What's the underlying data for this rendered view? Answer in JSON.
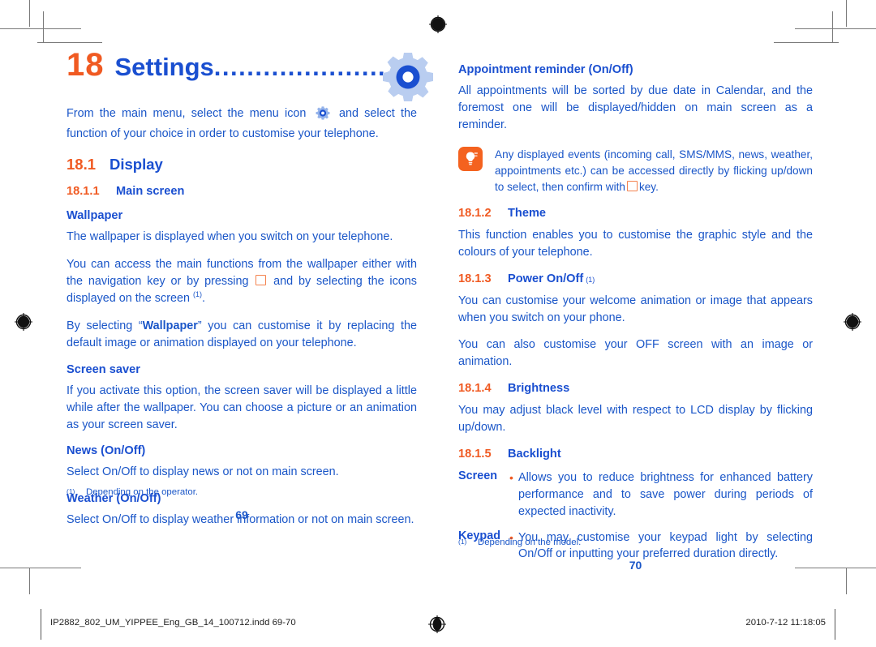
{
  "document": {
    "chapter": {
      "number": "18",
      "name": "Settings",
      "leader": "..........................",
      "gear_icon": "gear-icon"
    },
    "intro": {
      "before_icon": "From the main menu, select the menu icon",
      "after_icon": "and select the function of your choice in order to customise your telephone.",
      "inline_icon": "gear-icon"
    }
  },
  "left_column": {
    "section": {
      "number": "18.1",
      "title": "Display"
    },
    "subsection": {
      "number": "18.1.1",
      "title": "Main screen"
    },
    "blocks": [
      {
        "heading": "Wallpaper",
        "paragraphs": [
          "The wallpaper is displayed when you switch on your telephone.",
          "You can access the main functions from the wallpaper either with the navigation key or by pressing ",
          " and by selecting the icons displayed on the screen ",
          "By selecting “Wallpaper” you can customise it by replacing the default image or animation displayed on your telephone."
        ]
      },
      {
        "heading": "Screen saver",
        "paragraph": "If you activate this option, the screen saver will be displayed a little while after the wallpaper. You can choose a picture or an animation as your screen saver."
      },
      {
        "heading": "News (On/Off)",
        "paragraph": "Select On/Off to display news or not on main screen."
      },
      {
        "heading": "Weather (On/Off)",
        "paragraph": "Select On/Off to display weather information or not on main screen."
      }
    ],
    "wallpaper_emphasis": "Wallpaper",
    "wallpaper_lead": "By selecting “",
    "wallpaper_tail": "” you can customise it by replacing the default image or animation displayed on your telephone.",
    "footnote": {
      "mark": "(1)",
      "text": "Depending on the operator."
    },
    "page_number": "69"
  },
  "right_column": {
    "blocks": [
      {
        "heading": "Appointment reminder (On/Off)",
        "paragraph": "All appointments will be sorted by due date in Calendar, and the foremost one will be displayed/hidden on main screen as a reminder."
      }
    ],
    "tip": {
      "icon": "lightbulb-tip-icon",
      "text_before_key": "Any displayed events (incoming call, SMS/MMS, news, weather, appointments  etc.)  can be accessed directly by flicking up/down to select, then confirm with",
      "text_after_key": "key."
    },
    "theme": {
      "number": "18.1.2",
      "title": "Theme",
      "paragraph": "This function enables you to customise the graphic style and the colours of your telephone."
    },
    "power": {
      "number": "18.1.3",
      "title": "Power On/Off",
      "footnote_mark": "(1)",
      "paragraph_1": "You can customise your welcome animation or image that appears when you switch on your phone.",
      "paragraph_2": "You can also customise your OFF screen with an image or animation."
    },
    "brightness": {
      "number": "18.1.4",
      "title": "Brightness",
      "paragraph": "You may adjust black level with respect to LCD display by flicking up/down."
    },
    "backlight": {
      "number": "18.1.5",
      "title": "Backlight",
      "rows": [
        {
          "term": "Screen",
          "bullet": "•",
          "desc": "Allows you to reduce brightness for enhanced battery performance and to save power during periods of expected inactivity."
        },
        {
          "term": "Keypad",
          "bullet": "•",
          "desc": "You may customise your keypad light by selecting On/Off or inputting your preferred duration directly."
        }
      ]
    },
    "footnote": {
      "mark": "(1)",
      "text": "Depending on the model."
    },
    "page_number": "70"
  },
  "status_bar": {
    "file_name": "IP2882_802_UM_YIPPEE_Eng_GB_14_100712.indd   69-70",
    "date_time": "2010-7-12   11:18:05",
    "registration_icon": "registration-target-icon"
  },
  "colors": {
    "orange": "#f05a22",
    "blue": "#1a4fd0",
    "body_blue": "#1a56c8",
    "tip_orange": "#f4621f",
    "gear_light": "#b9cdf0",
    "gear_ring": "#1a4fd0"
  }
}
